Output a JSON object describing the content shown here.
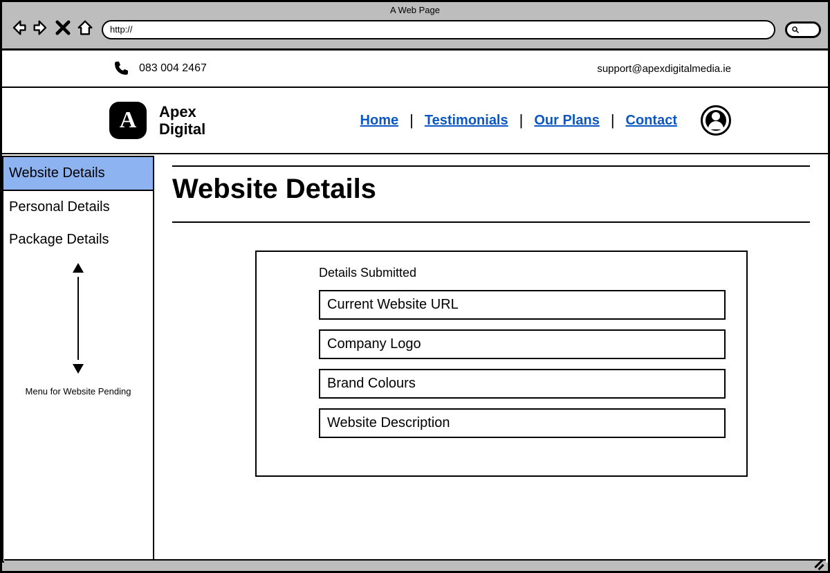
{
  "browser": {
    "title": "A Web Page",
    "url_value": "http://"
  },
  "topbar": {
    "phone": "083 004 2467",
    "email": "support@apexdigitalmedia.ie"
  },
  "header": {
    "logo_mark": "A",
    "logo_line1": "Apex",
    "logo_line2": "Digital",
    "nav": {
      "home": "Home",
      "testimonials": "Testimonials",
      "plans": "Our Plans",
      "contact": "Contact"
    }
  },
  "sidebar": {
    "items": [
      {
        "label": "Website Details"
      },
      {
        "label": "Personal Details"
      },
      {
        "label": "Package Details"
      }
    ],
    "note": "Menu for Website Pending"
  },
  "main": {
    "title": "Website Details",
    "panel_label": "Details Submitted",
    "fields": [
      "Current Website URL",
      "Company Logo",
      "Brand Colours",
      "Website Description"
    ]
  }
}
